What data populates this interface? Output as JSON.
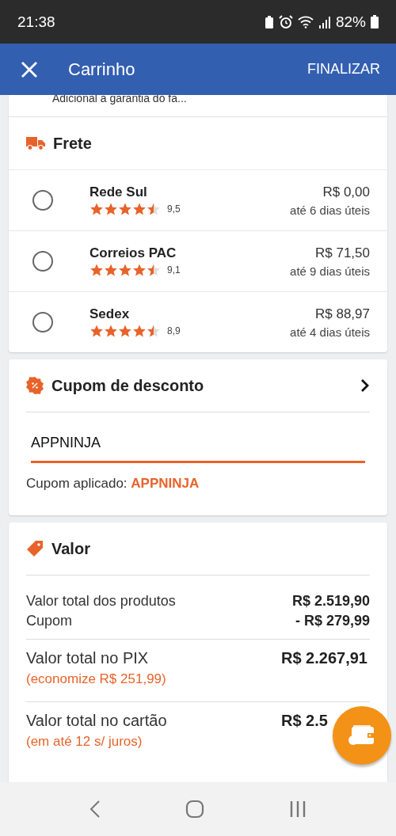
{
  "status_bar": {
    "time": "21:38",
    "battery": "82%"
  },
  "app_bar": {
    "title": "Carrinho",
    "action": "FINALIZAR"
  },
  "cut_line": "Adicional a garantia do fa...",
  "shipping": {
    "title": "Frete",
    "options": [
      {
        "name": "Rede Sul",
        "stars": 4.5,
        "score": "9,5",
        "price": "R$ 0,00",
        "eta": "até 6 dias úteis",
        "selected": false
      },
      {
        "name": "Correios PAC",
        "stars": 4.5,
        "score": "9,1",
        "price": "R$ 71,50",
        "eta": "até 9 dias úteis",
        "selected": false
      },
      {
        "name": "Sedex",
        "stars": 4.5,
        "score": "8,9",
        "price": "R$ 88,97",
        "eta": "até 4 dias úteis",
        "selected": false
      }
    ]
  },
  "coupon": {
    "title": "Cupom de desconto",
    "value": "APPNINJA",
    "applied": "Cupom aplicado: **APPNINJA**"
  },
  "summary": {
    "title": "Valor",
    "lines": [
      {
        "label": "Valor total dos produtos",
        "value": "R$ 2.519,90"
      },
      {
        "label": "Cupom",
        "value": "- R$ 279,99"
      }
    ],
    "totals": [
      {
        "label": "Valor total no PIX",
        "note": "(economize R$ 251,99)",
        "value": "R$ 2.267,91"
      },
      {
        "label": "Valor total no cartão",
        "note": "(em até 12 s/ juros)",
        "value": "R$ 2.5"
      }
    ]
  }
}
